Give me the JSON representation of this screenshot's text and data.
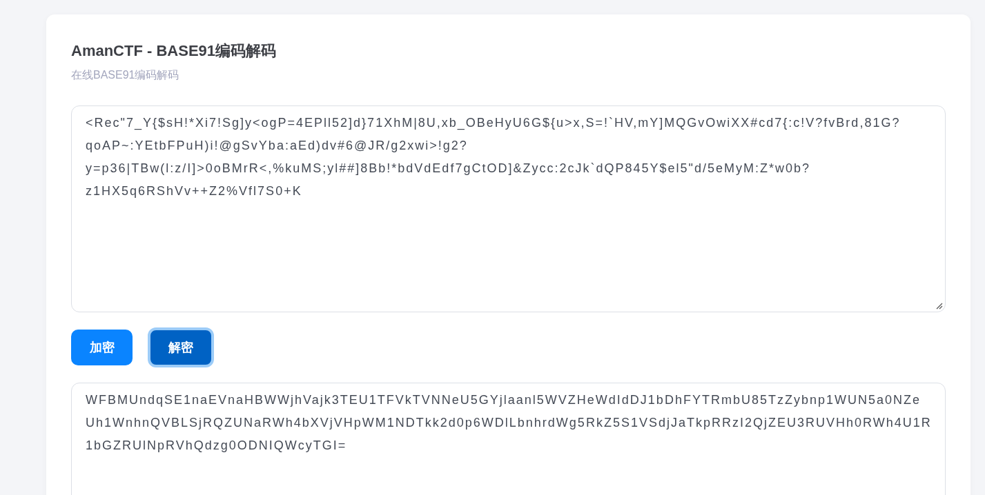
{
  "page": {
    "title": "AmanCTF - BASE91编码解码",
    "subtitle": "在线BASE91编码解码"
  },
  "input": {
    "lines": [
      "<Rec\"7_Y{$sH!*Xi7!Sg]y<ogP=4EPll52]d}71XhM|8U,xb_OBeHyU6G${u>x,S=!`HV,mY]MQGvOwiXX#cd7{:c!V?fvBrd,81G?",
      "qoAP~:YEtbFPuH)i!@gSvYba:aEd)dv#6@JR/g2xwi>!g2?",
      "y=p36|TBw(l:z/I]>0oBMrR<,%kuMS;yl##]8Bb!*bdVdEdf7gCtOD]&Zycc:2cJk`dQP845Y$el5\"d/5eMyM:Z*w0b?",
      "z1HX5q6RShVv++Z2%Vfl7S0+K"
    ]
  },
  "buttons": [
    {
      "label": "加密",
      "selected": false
    },
    {
      "label": "解密",
      "selected": true
    }
  ],
  "output": {
    "lines": [
      "WFBMUndqSE1naEVnaHBWWjhVajk3TEU1TFVkTVNNeU5GYjlaanl5WVZHeWdIdDJ1bDhFYTRmbU85TzZybnp1WUN5a0NZe",
      "Uh1WnhnQVBLSjRQZUNaRWh4bXVjVHpWM1NDTkk2d0p6WDlLbnhrdWg5RkZ5S1VSdjJaTkpRRzI2QjZEU3RUVHh0RWh4U1R",
      "1bGZRUlNpRVhQdzg0ODNIQWcyTGI="
    ]
  }
}
